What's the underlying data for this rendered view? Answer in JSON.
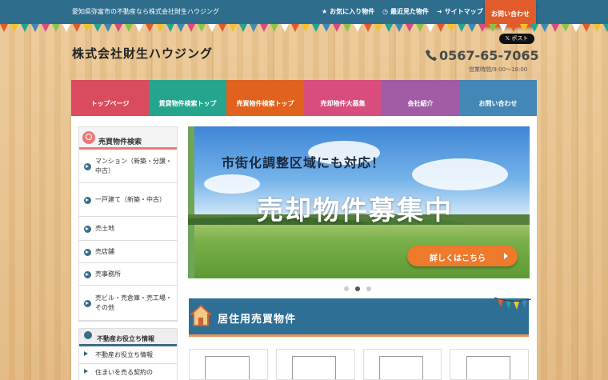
{
  "topbar": {
    "tagline": "愛知県弥富市の不動産なら株式会社財生ハウジング",
    "links": [
      {
        "label": "お気に入り物件",
        "icon": "star-icon"
      },
      {
        "label": "最近見た物件",
        "icon": "clock-icon"
      },
      {
        "label": "サイトマップ",
        "icon": "arrow-icon"
      }
    ],
    "contact": "お問い合わせ"
  },
  "header": {
    "logo": "株式会社財生ハウジング",
    "xpost": "𝕏 ポスト",
    "phone": "0567-65-7065",
    "hours": "営業時間/9:00～18:00"
  },
  "nav": [
    {
      "label": "トップページ",
      "color": "#d94b5e"
    },
    {
      "label": "賃貸物件検索トップ",
      "color": "#26a58e"
    },
    {
      "label": "売買物件検索トップ",
      "color": "#e0621e"
    },
    {
      "label": "売却物件大募集",
      "color": "#d84c7e"
    },
    {
      "label": "会社紹介",
      "color": "#a15ba4"
    },
    {
      "label": "お問い合わせ",
      "color": "#4287b5"
    }
  ],
  "sidebar": {
    "title": "売買物件検索",
    "items": [
      "マンション（新築・分譲・中古）",
      "一戸建て（新築・中古）",
      "売土地",
      "売店舗",
      "売事務所",
      "売ビル・売倉庫・売工場・その他"
    ],
    "info_title": "不動産お役立ち情報",
    "info_items": [
      "不動産お役立ち情報",
      "住まいを売る契約の"
    ]
  },
  "banner": {
    "subtitle": "市街化調整区域にも対応！",
    "headline": "売却物件募集中",
    "button": "詳しくはこちら",
    "active_slide": 2,
    "slides": 3
  },
  "section": {
    "title": "居住用売買物件"
  },
  "colors": {
    "topbar": "#2f6d8c",
    "accent": "#e25b2b"
  }
}
